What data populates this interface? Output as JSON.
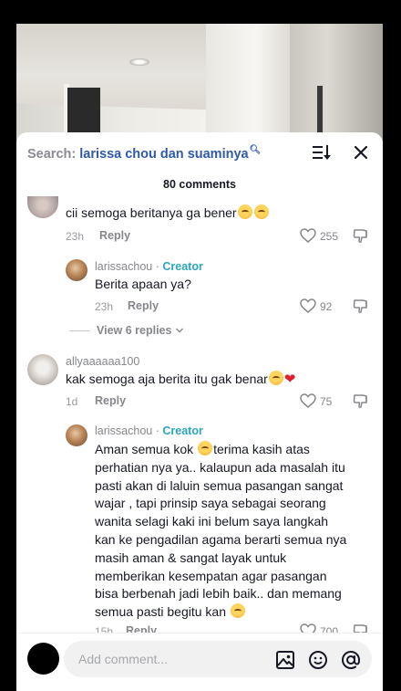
{
  "search": {
    "prefix": "Search:",
    "query": "larissa chou dan suaminya"
  },
  "comments_count": "80 comments",
  "comments": [
    {
      "text": "cii semoga beritanya ga bener",
      "time": "23h",
      "reply": "Reply",
      "likes": "255"
    },
    {
      "username": "larissachou",
      "badge": "Creator",
      "text": "Berita apaan ya?",
      "time": "23h",
      "reply": "Reply",
      "likes": "92"
    },
    {
      "username": "allyaaaaaa100",
      "text": "kak semoga aja berita itu gak benar",
      "time": "1d",
      "reply": "Reply",
      "likes": "75"
    },
    {
      "username": "larissachou",
      "badge": "Creator",
      "lines": [
        "Aman semua kok",
        "terima kasih atas",
        "perhatian nya ya.. kalaupun ada masalah itu",
        "pasti akan di laluin semua pasangan sangat",
        "wajar , tapi prinsip saya sebagai seorang",
        "wanita selagi kaki ini belum saya langkah",
        "kan ke pengadilan agama berarti semua nya",
        "masih aman & sangat layak untuk",
        "memberikan kesempatan agar pasangan",
        "bisa berbenah jadi lebih baik.. dan memang",
        "semua pasti begitu kan"
      ],
      "time": "15h",
      "reply": "Reply",
      "likes": "700"
    }
  ],
  "view_replies": "View 6 replies",
  "separator_dot": "·",
  "input": {
    "placeholder": "Add comment..."
  },
  "colors": {
    "creator": "#2ba6c2",
    "search_query": "#2f5aa5",
    "heart": "#e0202f"
  },
  "icons": [
    "search-icon",
    "sort-icon",
    "close-icon",
    "heart-icon",
    "dislike-icon",
    "chevron-down-icon",
    "image-icon",
    "emoji-icon",
    "at-icon"
  ]
}
